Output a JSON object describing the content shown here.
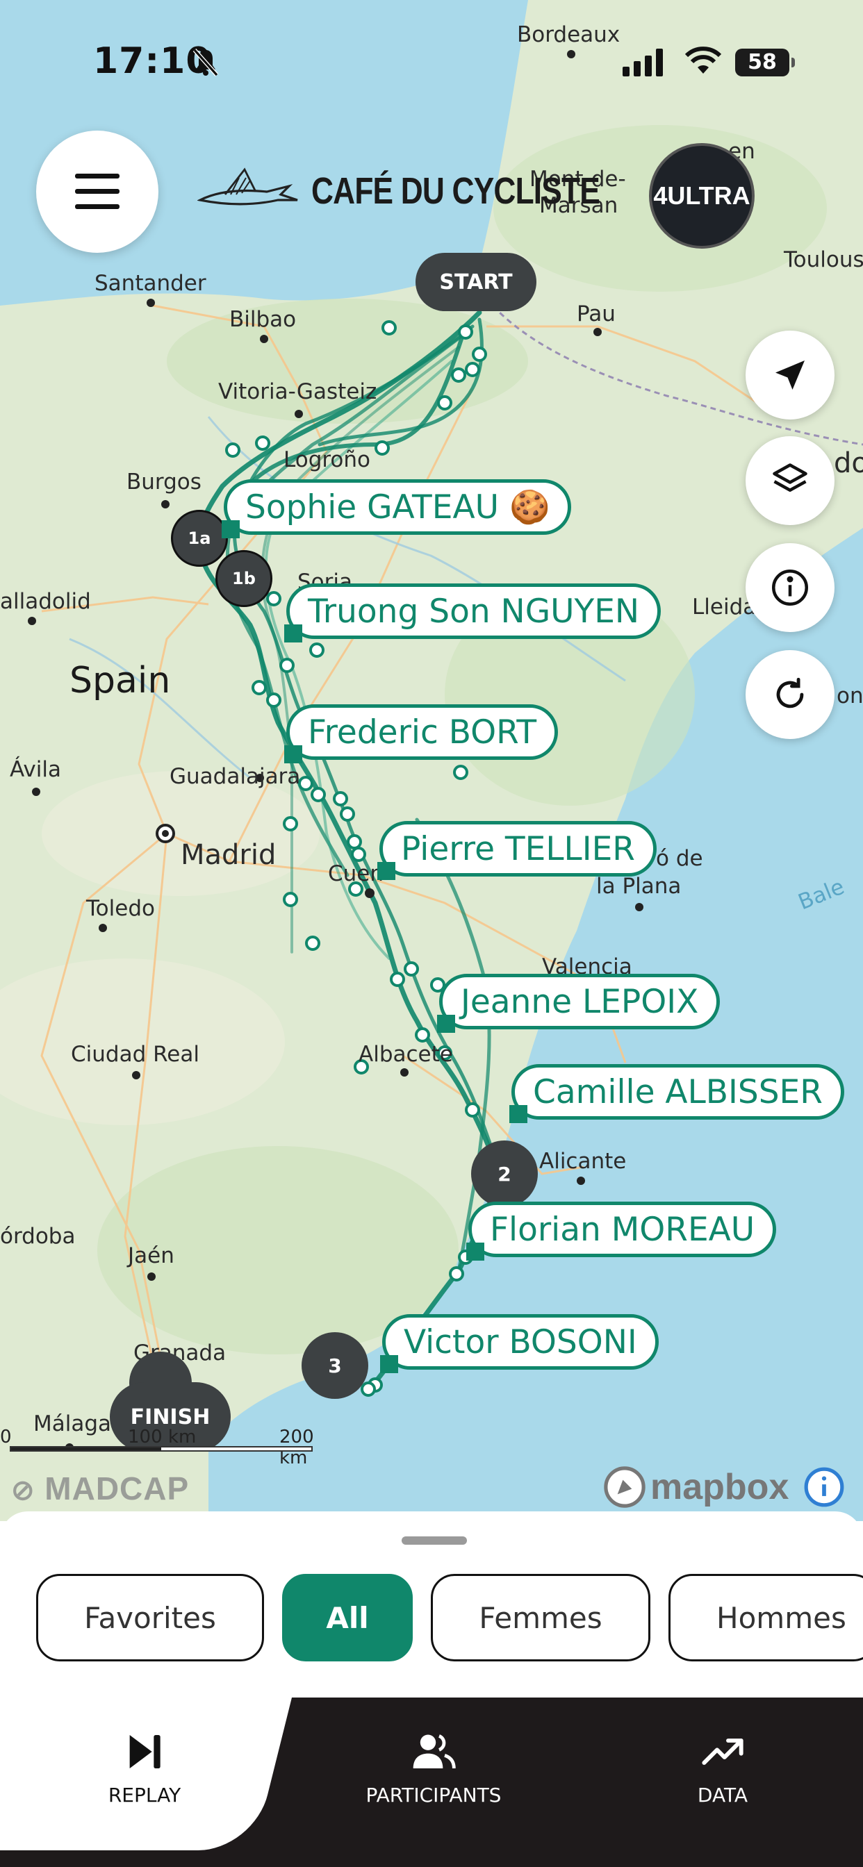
{
  "status_bar": {
    "time": "17:10",
    "battery": "58"
  },
  "header": {
    "brand": "CAFÉ DU CYCLISTE",
    "partner_logo": "4ULTRA"
  },
  "map": {
    "cities": [
      {
        "name": "Bordeaux"
      },
      {
        "name": "Mont-de-"
      },
      {
        "name": "Marsan"
      },
      {
        "name": "Toulous"
      },
      {
        "name": "Pau"
      },
      {
        "name": "Santander"
      },
      {
        "name": "Bilbao"
      },
      {
        "name": "Vitoria-Gasteiz"
      },
      {
        "name": "Logroño"
      },
      {
        "name": "Burgos"
      },
      {
        "name": "alladolid"
      },
      {
        "name": "Soria"
      },
      {
        "name": "Lleida"
      },
      {
        "name": "Ávila"
      },
      {
        "name": "Guadalajara"
      },
      {
        "name": "Madrid"
      },
      {
        "name": "Toledo"
      },
      {
        "name": "Cuen"
      },
      {
        "name": "ó de"
      },
      {
        "name": "la Plana"
      },
      {
        "name": "Valencia"
      },
      {
        "name": "Ciudad Real"
      },
      {
        "name": "Albacete"
      },
      {
        "name": "Alicante"
      },
      {
        "name": "órdoba"
      },
      {
        "name": "Jaén"
      },
      {
        "name": "Granada"
      },
      {
        "name": "Málaga"
      },
      {
        "name": "do"
      },
      {
        "name": "ona"
      },
      {
        "name": "Bale"
      },
      {
        "name": "en"
      }
    ],
    "country_label": "Spain",
    "start_label": "START",
    "finish_label": "FINISH",
    "checkpoints": [
      "1a",
      "1b"
    ],
    "clusters": [
      "2",
      "3"
    ],
    "riders": [
      {
        "name": "Sophie GATEAU 🍪"
      },
      {
        "name": "Truong Son NGUYEN"
      },
      {
        "name": "Frederic BORT"
      },
      {
        "name": "Pierre TELLIER"
      },
      {
        "name": "Jeanne LEPOIX"
      },
      {
        "name": "Camille ALBISSER"
      },
      {
        "name": "Florian MOREAU"
      },
      {
        "name": "Victor BOSONI"
      }
    ],
    "scale": {
      "left": "0",
      "mid": "100 km",
      "right": "200 km"
    },
    "attribution_left": "MADCAP",
    "attribution_right": "mapbox"
  },
  "filters": {
    "chips": [
      "Favorites",
      "All",
      "Femmes",
      "Hommes"
    ],
    "active": "All"
  },
  "tabs": {
    "replay": "REPLAY",
    "participants": "PARTICIPANTS",
    "data": "DATA"
  },
  "colors": {
    "accent": "#10876b",
    "dark": "#3d4143",
    "tabbar": "#1e1a1b"
  }
}
